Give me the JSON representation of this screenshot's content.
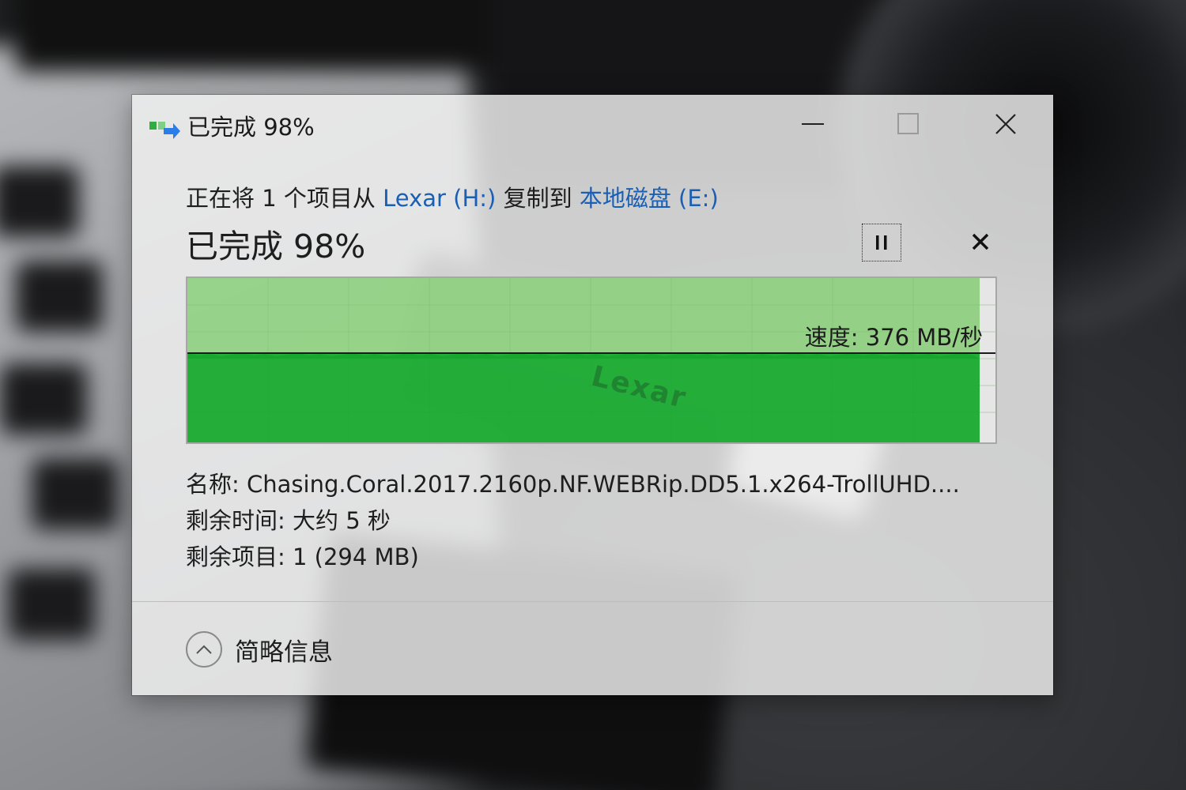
{
  "window": {
    "title": "已完成 98%",
    "icon": "copy-arrow-icon",
    "controls": [
      "minimize-icon",
      "maximize-icon",
      "close-icon"
    ]
  },
  "copy": {
    "prefix": "正在将 1 个项目从 ",
    "source": "Lexar (H:)",
    "middle": " 复制到 ",
    "destination": "本地磁盘 (E:)"
  },
  "progress": {
    "label": "已完成 98%",
    "percent": 98
  },
  "graph": {
    "speed_label": "速度: 376 MB/秒"
  },
  "details": {
    "name_label": "名称: ",
    "name_value": "Chasing.Coral.2017.2160p.NF.WEBRip.DD5.1.x264-TrollUHD....",
    "time_label": "剩余时间: ",
    "time_value": "大约 5 秒",
    "items_label": "剩余项目: ",
    "items_value": "1 (294 MB)"
  },
  "footer": {
    "toggle_label": "简略信息"
  },
  "colors": {
    "link": "#1a5fb4",
    "graph_light": "#76c862",
    "graph_dark": "#16a82c"
  }
}
